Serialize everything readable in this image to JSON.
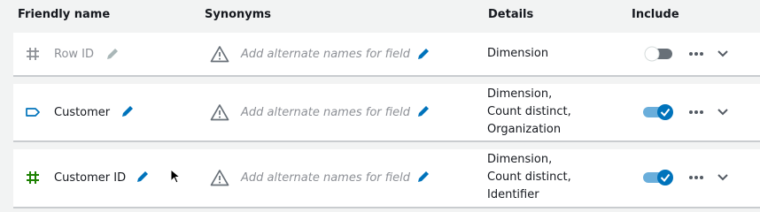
{
  "header": {
    "friendly_name": "Friendly name",
    "synonyms": "Synonyms",
    "details": "Details",
    "include": "Include"
  },
  "colors": {
    "accent": "#0073bb",
    "toggle_on": "#0073bb",
    "toggle_off": "#687078",
    "measure_green": "#1d8102",
    "muted": "#8d9096"
  },
  "rows": [
    {
      "name": "Row ID",
      "icon": "hash-icon",
      "synonyms_placeholder": "Add alternate names for field",
      "details": [
        "Dimension"
      ],
      "include": false
    },
    {
      "name": "Customer",
      "icon": "tag-icon",
      "synonyms_placeholder": "Add alternate names for field",
      "details": [
        "Dimension,",
        "Count distinct,",
        "Organization"
      ],
      "include": true
    },
    {
      "name": "Customer ID",
      "icon": "hash-icon",
      "synonyms_placeholder": "Add alternate names for field",
      "details": [
        "Dimension,",
        "Count distinct,",
        "Identifier"
      ],
      "include": true
    }
  ]
}
